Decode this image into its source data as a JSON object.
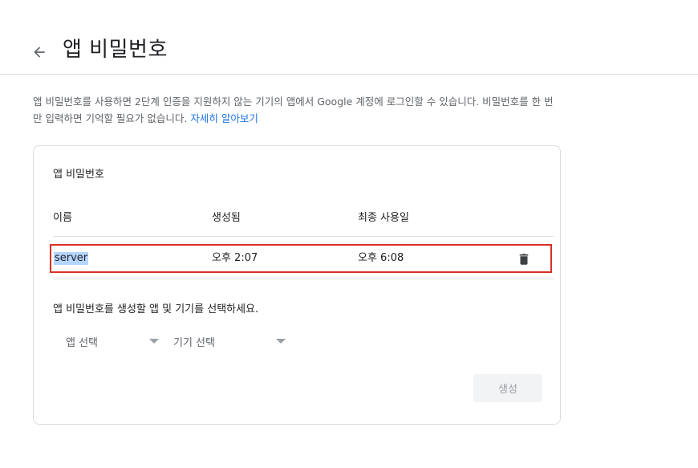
{
  "header": {
    "title": "앱 비밀번호",
    "back_icon": "arrow-left-icon"
  },
  "description": {
    "text": "앱 비밀번호를 사용하면 2단계 인증을 지원하지 않는 기기의 앱에서 Google 계정에 로그인할 수 있습니다. 비밀번호를 한 번만 입력하면 기억할 필요가 없습니다. ",
    "link_label": "자세히 알아보기"
  },
  "card": {
    "title": "앱 비밀번호",
    "columns": {
      "name": "이름",
      "created": "생성됨",
      "last_used": "최종 사용일"
    },
    "rows": [
      {
        "name": "server",
        "created": "오후 2:07",
        "last_used": "오후 6:08",
        "delete_icon": "trash-icon"
      }
    ],
    "instruction": "앱 비밀번호를 생성할 앱 및 기기를 선택하세요.",
    "app_select": {
      "label": "앱 선택"
    },
    "device_select": {
      "label": "기기 선택"
    },
    "generate_label": "생성"
  },
  "colors": {
    "link": "#1a73e8",
    "highlight_border": "#d93025",
    "selection": "#b4d5fe",
    "disabled_button_bg": "#f1f3f4",
    "disabled_button_text": "#9aa0a6"
  }
}
